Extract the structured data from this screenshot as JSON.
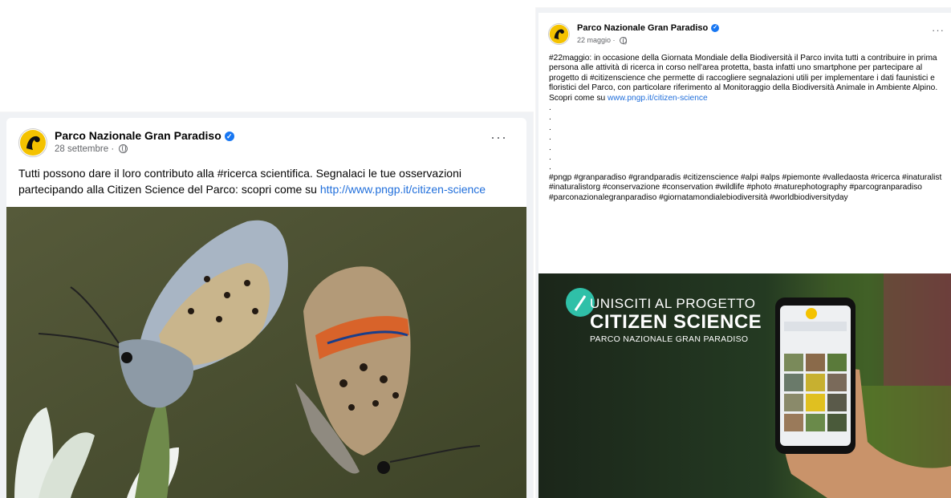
{
  "posts": [
    {
      "author": "Parco Nazionale Gran Paradiso",
      "date": "28 settembre",
      "text": "Tutti possono dare il loro contributo alla #ricerca scientifica. Segnalaci le tue osservazioni partecipando alla Citizen Science del Parco: scopri come su ",
      "link": "http://www.pngp.it/citizen-science",
      "image_alt": "two butterflies on a white flower"
    },
    {
      "author": "Parco Nazionale Gran Paradiso",
      "date": "22 maggio",
      "text": "#22maggio: in occasione della Giornata Mondiale della Biodiversità il Parco invita tutti a contribuire in prima persona alle attività di ricerca in corso nell'area protetta, basta infatti uno smartphone per partecipare al progetto di #citizenscience che permette di raccogliere segnalazioni utili per implementare i dati faunistici e floristici del Parco, con particolare riferimento al Monitoraggio della Biodiversità Animale in Ambiente Alpino.",
      "cta_text": "Scopri come su ",
      "link": "www.pngp.it/citizen-science",
      "dots": [
        ".",
        ".",
        ".",
        ".",
        ".",
        ".",
        "."
      ],
      "hashtags": "#pngp #granparadiso #grandparadis #citizenscience #alpi #alps #piemonte #valledaosta #ricerca #inaturalist #inaturalistorg #conservazione #conservation #wildlife #photo #naturephotography #parcogranparadiso #parconazionalegranparadiso #giornatamondialebiodiversità #worldbiodiversityday",
      "image": {
        "line1": "UNISCITI AL PROGETTO",
        "line2": "CITIZEN SCIENCE",
        "line3": "PARCO NAZIONALE GRAN PARADISO"
      }
    }
  ],
  "ui": {
    "more": "···",
    "separator": " · ",
    "verified": "✓"
  },
  "colors": {
    "link": "#216fdb",
    "verified": "#1877f2",
    "meta": "#65676b",
    "feed_bg": "#f0f2f5"
  }
}
